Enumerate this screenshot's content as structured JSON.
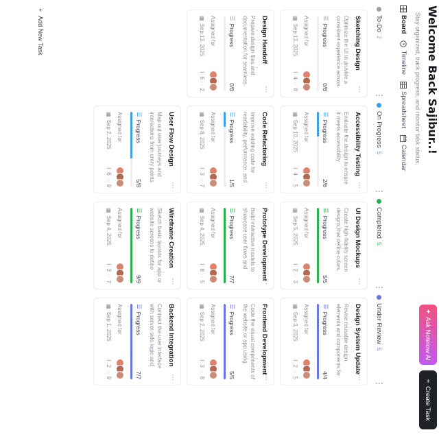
{
  "header": {
    "welcome": "Welcome Back Sajibur..!",
    "subtitle": "Stay organized, track progress, and monitor task status.",
    "views": [
      {
        "label": "Board",
        "icon": "board-icon",
        "active": true
      },
      {
        "label": "Timeline",
        "icon": "clock-icon",
        "active": false
      },
      {
        "label": "Spreadsheet",
        "icon": "table-icon",
        "active": false
      },
      {
        "label": "Calendar",
        "icon": "calendar-icon",
        "active": false
      }
    ],
    "ask_ai_label": "Ask Notelow AI",
    "create_label": "Create Task"
  },
  "columns": [
    {
      "name": "To-Do",
      "count": "2",
      "dot": "#9aa0a6"
    },
    {
      "name": "On Progress",
      "count": "5",
      "dot": "#3aa0e8"
    },
    {
      "name": "Completed",
      "count": "5",
      "dot": "#26b14a"
    },
    {
      "name": "Under Review",
      "count": "5",
      "dot": "#6b74e6"
    }
  ],
  "cards": [
    {
      "title": "Sketching Design",
      "desc": "Optimize the UI to provide a consistent experience across diff...",
      "progress_label": "Progress",
      "progress": "0/8",
      "fill": 0,
      "color": "#9aa0a6",
      "assigned": "Assigned for",
      "date": "Sep 13, 2025",
      "attach": "4",
      "comments": "8"
    },
    {
      "title": "Design Handoff",
      "desc": "Prepare design files and documentation for seamless trans...",
      "progress_label": "Progress",
      "progress": "0/8",
      "fill": 0,
      "color": "#9aa0a6",
      "assigned": "Assigned for",
      "date": "Sep 13, 2025",
      "attach": "6",
      "comments": "2"
    },
    {
      "title": "Accessibility Testing",
      "desc": "Evaluate the design to ensure it meets accessibility standards for...",
      "progress_label": "Progress",
      "progress": "2/6",
      "fill": 0.33,
      "color": "#3aa0e8",
      "assigned": "Assigned for",
      "date": "Sep 10, 2025",
      "attach": "4",
      "comments": "5"
    },
    {
      "title": "Code Refactoring",
      "desc": "Improve existing code for readability, performance, and mai...",
      "progress_label": "Progress",
      "progress": "1/5",
      "fill": 0.2,
      "color": "#3aa0e8",
      "assigned": "Assigned for",
      "date": "Sep 8, 2025",
      "attach": "3",
      "comments": "7"
    },
    {
      "title": "User Flow Design",
      "desc": "Map out user journeys and interactions from entry points to fi...",
      "progress_label": "Progress",
      "progress": "5/8",
      "fill": 0.62,
      "color": "#3aa0e8",
      "assigned": "Assigned for",
      "date": "Sep 2, 2025",
      "attach": "6",
      "comments": "9"
    },
    {
      "title": "UI Design Mockups",
      "desc": "Create high-fidelity screen designs that define colors, typography, an...",
      "progress_label": "Progress",
      "progress": "5/5",
      "fill": 1,
      "color": "#26b14a",
      "assigned": "Assigned for",
      "date": "Sep 5, 2025",
      "attach": "2",
      "comments": "3"
    },
    {
      "title": "Prototype Development",
      "desc": "Build interactive models to showcase user flows and gather f...",
      "progress_label": "Progress",
      "progress": "7/7",
      "fill": 1,
      "color": "#26b14a",
      "assigned": "Assigned for",
      "date": "Sep 4, 2025",
      "attach": "8",
      "comments": "5"
    },
    {
      "title": "Wireframe Creation",
      "desc": "Sketch basic layouts for app or website screens to define struc...",
      "progress_label": "Progress",
      "progress": "9/9",
      "fill": 1,
      "color": "#26b14a",
      "assigned": "Assigned for",
      "date": "Sep 4, 2025",
      "attach": "3",
      "comments": "7"
    },
    {
      "title": "Design System Update",
      "desc": "Revise reusable design elements and components for consistent br...",
      "progress_label": "Progress",
      "progress": "4/4",
      "fill": 1,
      "color": "#6b74e6",
      "assigned": "Assigned for",
      "date": "Sep 3, 2025",
      "attach": "2",
      "comments": "5"
    },
    {
      "title": "Frontend Development",
      "desc": "Code the visual components of the website or app using HTML, CSS,...",
      "progress_label": "Progress",
      "progress": "5/5",
      "fill": 1,
      "color": "#6b74e6",
      "assigned": "Assigned for",
      "date": "Sep 2, 2025",
      "attach": "3",
      "comments": "8"
    },
    {
      "title": "Backend Integration",
      "desc": "Connect the user interface with server-side logic and databases f...",
      "progress_label": "Progress",
      "progress": "7/7",
      "fill": 1,
      "color": "#6b74e6",
      "assigned": "Assigned for",
      "date": "Sep 1, 2025",
      "attach": "2",
      "comments": "9"
    }
  ],
  "add_task_label": "Add New Task",
  "avatar_colors": [
    "#e0826a",
    "#b0694f",
    "#c98c75"
  ]
}
